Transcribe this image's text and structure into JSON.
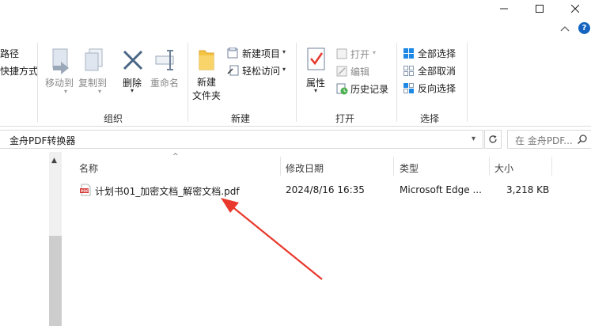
{
  "ribbon": {
    "partial_left": [
      "路径",
      "快捷方式"
    ],
    "organize": {
      "label": "组织",
      "move_to": "移动到",
      "copy_to": "复制到",
      "delete": "删除",
      "rename": "重命名"
    },
    "new": {
      "label": "新建",
      "new_item": "新建项目",
      "easy_access": "轻松访问",
      "new_folder_line1": "新建",
      "new_folder_line2": "文件夹"
    },
    "open": {
      "label": "打开",
      "properties": "属性",
      "open": "打开",
      "edit": "编辑",
      "history": "历史记录"
    },
    "select": {
      "label": "选择",
      "select_all": "全部选择",
      "select_none": "全部取消",
      "invert": "反向选择"
    }
  },
  "address": {
    "path": "金舟PDF转换器",
    "search_placeholder": "在 金舟PDF..."
  },
  "columns": {
    "name": "名称",
    "modified": "修改日期",
    "type": "类型",
    "size": "大小"
  },
  "files": [
    {
      "name": "计划书01_加密文档_解密文档.pdf",
      "modified": "2024/8/16 16:35",
      "type": "Microsoft Edge ...",
      "size": "3,218 KB"
    }
  ],
  "colors": {
    "accent_blue": "#1565c0",
    "arrow_red": "#e8392c",
    "folder_yellow": "#f5c342"
  }
}
